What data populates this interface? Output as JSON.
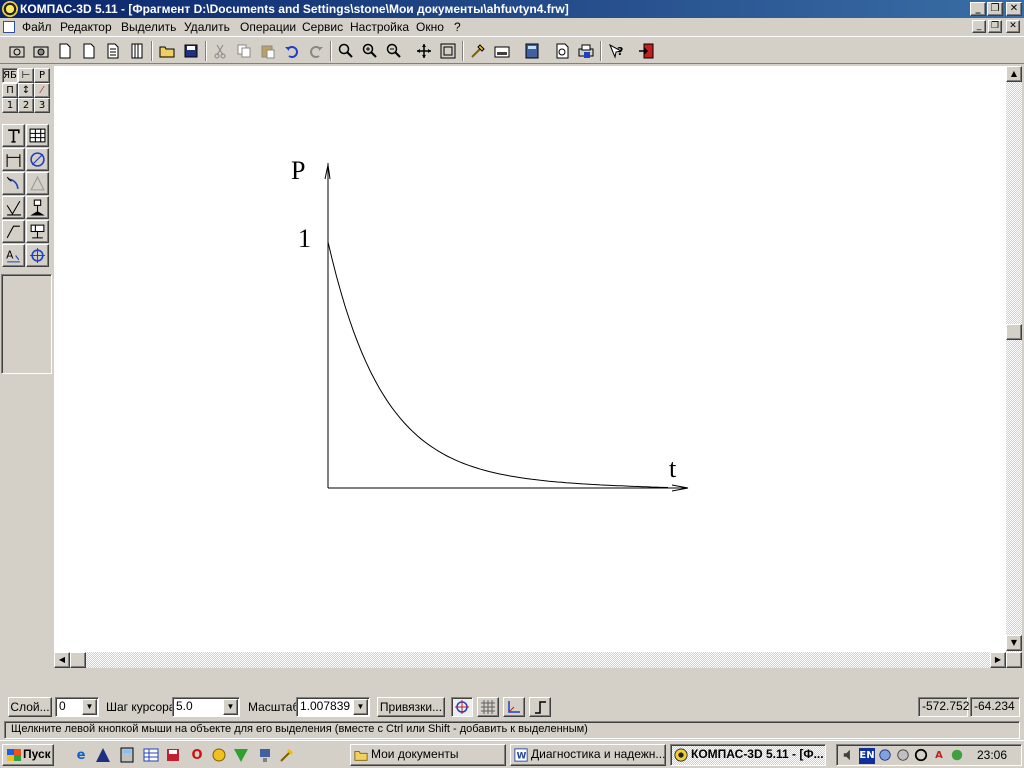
{
  "window": {
    "title": "КОМПАС-3D 5.11 - [Фрагмент D:\\Documents and Settings\\stone\\Мои документы\\ahfuvtyn4.frw]",
    "minimize": "_",
    "restore": "❐",
    "close": "✕"
  },
  "menu": {
    "items": [
      "Файл",
      "Редактор",
      "Выделить",
      "Удалить",
      "Операции",
      "Сервис",
      "Настройка",
      "Окно",
      "?"
    ]
  },
  "left_panel": {
    "small_buttons": [
      "ЯБ",
      "⊢",
      "P",
      "П",
      "↕",
      "⁄",
      "1",
      "2",
      "3"
    ]
  },
  "drawing": {
    "y_axis_label": "P",
    "x_axis_label": "t",
    "y_tick_label": "1"
  },
  "status": {
    "layer_button": "Слой...",
    "layer_value": "0",
    "cursor_step_label": "Шаг курсора",
    "cursor_step_value": "5.0",
    "scale_label": "Масштаб",
    "scale_value": "1.007839",
    "snaps_button": "Привязки...",
    "coord_x": "-572.752",
    "coord_y": "-64.234",
    "hint": "Щелкните левой кнопкой мыши на объекте для его выделения (вместе с Ctrl или Shift - добавить к выделенным)"
  },
  "taskbar": {
    "start": "Пуск",
    "tasks": [
      {
        "label": "Мои документы",
        "active": false
      },
      {
        "label": "Диагностика и надежн...",
        "active": false
      },
      {
        "label": "КОМПАС-3D 5.11 - [Ф...",
        "active": true
      }
    ],
    "tray_lang": "EN",
    "clock": "23:06"
  }
}
